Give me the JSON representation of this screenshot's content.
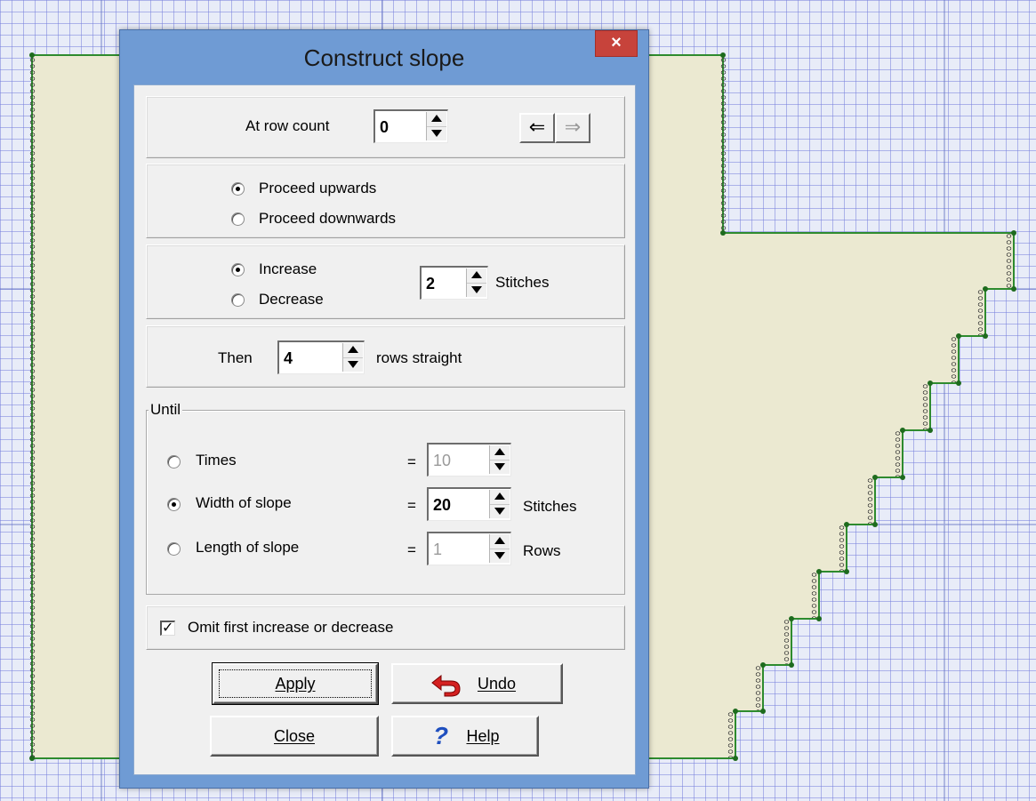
{
  "dialog": {
    "title": "Construct slope",
    "close_glyph": "×",
    "row_count": {
      "label": "At row count",
      "value": "0"
    },
    "nav": {
      "back_glyph": "⇐",
      "forward_glyph": "⇒"
    },
    "direction": {
      "options": [
        "Proceed upwards",
        "Proceed downwards"
      ],
      "selected": "Proceed upwards"
    },
    "shaping": {
      "options": [
        "Increase",
        "Decrease"
      ],
      "selected": "Increase",
      "stitch_value": "2",
      "stitch_unit": "Stitches"
    },
    "straight": {
      "prefix": "Then",
      "value": "4",
      "suffix": "rows straight"
    },
    "until": {
      "legend": "Until",
      "rows": [
        {
          "label": "Times",
          "equals": "=",
          "value": "10",
          "unit": "",
          "selected": false,
          "enabled": false
        },
        {
          "label": "Width of slope",
          "equals": "=",
          "value": "20",
          "unit": "Stitches",
          "selected": true,
          "enabled": true
        },
        {
          "label": "Length of slope",
          "equals": "=",
          "value": "1",
          "unit": "Rows",
          "selected": false,
          "enabled": false
        }
      ]
    },
    "omit_first": {
      "label": "Omit first increase or decrease",
      "checked": true,
      "check_glyph": "✓"
    },
    "buttons": {
      "apply": "Apply",
      "undo": "Undo",
      "close": "Close",
      "help": "Help",
      "help_glyph": "?"
    }
  },
  "colors": {
    "shape_fill": "#ebe9d1",
    "outline": "#2e8b2e",
    "dialog_frame": "#6f9bd4",
    "close_button": "#c7433b",
    "undo_icon": "#d42020",
    "help_icon": "#1f4fbf"
  }
}
